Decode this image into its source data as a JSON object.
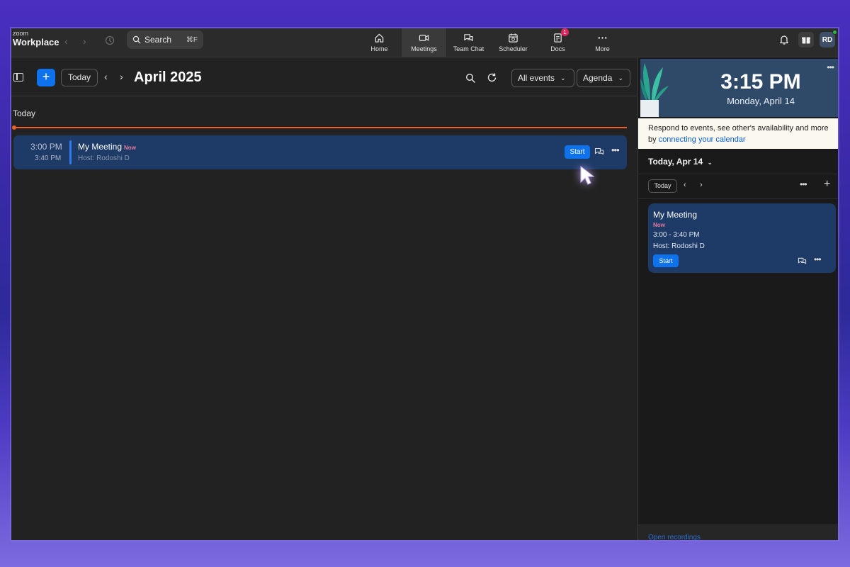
{
  "app": {
    "brand_small": "zoom",
    "brand_large": "Workplace"
  },
  "search": {
    "label": "Search",
    "shortcut": "⌘F"
  },
  "nav": {
    "tabs": [
      {
        "label": "Home",
        "icon": "home-icon"
      },
      {
        "label": "Meetings",
        "icon": "video-icon",
        "active": true
      },
      {
        "label": "Team Chat",
        "icon": "chat-icon"
      },
      {
        "label": "Scheduler",
        "icon": "calendar-clock-icon"
      },
      {
        "label": "Docs",
        "icon": "doc-icon",
        "badge": "1"
      },
      {
        "label": "More",
        "icon": "ellipsis-icon"
      }
    ]
  },
  "user": {
    "initials": "RD",
    "status_color": "#2bb24c"
  },
  "toolbar": {
    "today_label": "Today",
    "month_title": "April 2025",
    "filter_label": "All events",
    "view_label": "Agenda"
  },
  "agenda": {
    "day_label": "Today",
    "event": {
      "start": "3:00 PM",
      "end": "3:40 PM",
      "title": "My Meeting",
      "now": "Now",
      "host": "Host: Rodoshi D",
      "start_button": "Start"
    }
  },
  "right_panel": {
    "clock_time": "3:15 PM",
    "clock_date": "Monday, April 14",
    "connect_text": "Respond to events, see other's availability and more by ",
    "connect_link": "connecting your calendar",
    "date_header": "Today, Apr 14",
    "today_label": "Today",
    "card": {
      "title": "My Meeting",
      "now": "Now",
      "time": "3:00 - 3:40 PM",
      "host": "Host: Rodoshi D",
      "start_button": "Start"
    },
    "bottom_link": "Open recordings"
  },
  "colors": {
    "accent": "#0e72ed",
    "now_line": "#e8602c",
    "event_bg": "#1e3a66",
    "now_text": "#e57aa0"
  }
}
